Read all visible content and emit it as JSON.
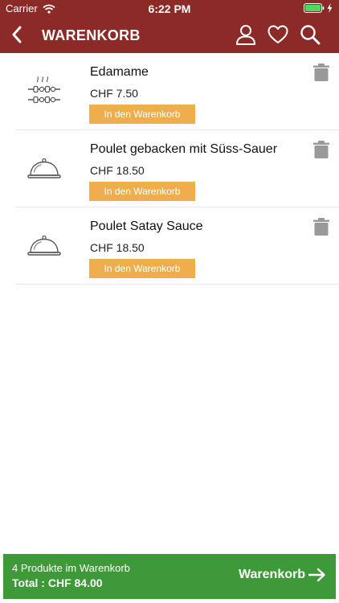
{
  "status_bar": {
    "carrier": "Carrier",
    "time": "6:22 PM"
  },
  "header": {
    "title": "WARENKORB",
    "background_color": "#8b2a27",
    "icons": [
      "chevron-left-icon",
      "user-icon",
      "heart-icon",
      "search-icon"
    ]
  },
  "cart": {
    "items": [
      {
        "name": "Edamame",
        "price": "CHF 7.50",
        "add_label": "In den Warenkorb",
        "thumbnail_icon": "skewer-icon"
      },
      {
        "name": "Poulet gebacken mit Süss-Sauer",
        "price": "CHF 18.50",
        "add_label": "In den Warenkorb",
        "thumbnail_icon": "food-cloche-icon"
      },
      {
        "name": "Poulet Satay Sauce",
        "price": "CHF 18.50",
        "add_label": "In den Warenkorb",
        "thumbnail_icon": "food-cloche-icon"
      }
    ],
    "add_button_color": "#f0ad4e"
  },
  "footer": {
    "count_text": "4 Produkte im Warenkorb",
    "total_text": "Total : CHF 84.00",
    "checkout_label": "Warenkorb",
    "background_color": "#3e9a38"
  }
}
